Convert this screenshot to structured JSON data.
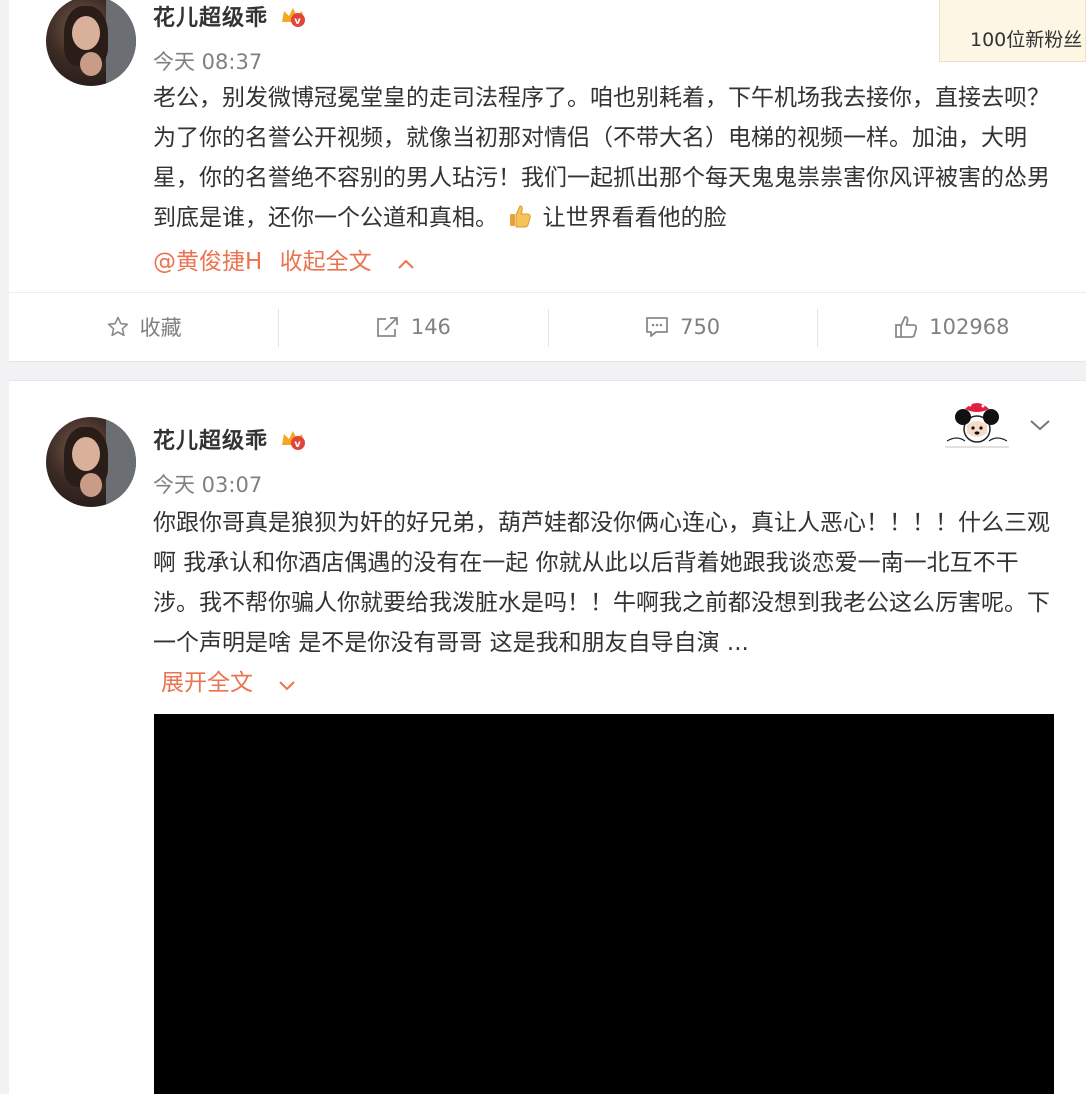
{
  "notification": {
    "text": "100位新粉丝"
  },
  "posts": [
    {
      "username": "花儿超级乖",
      "timestamp": "今天 08:37",
      "text": "老公，别发微博冠冕堂皇的走司法程序了。咱也别耗着，下午机场我去接你，直接去呗？为了你的名誉公开视频，就像当初那对情侣（不带大名）电梯的视频一样。加油，大明星，你的名誉绝不容别的男人玷污！我们一起抓出那个每天鬼鬼祟祟害你风评被害的怂男到底是谁，还你一个公道和真相。",
      "emoji_name": "thumbs-up-emoji",
      "text_after_emoji": "让世界看看他的脸",
      "mention": "@黄俊捷H",
      "collapse_label": "收起全文",
      "actions": {
        "favorite_label": "收藏",
        "repost_count": "146",
        "comment_count": "750",
        "like_count": "102968"
      }
    },
    {
      "username": "花儿超级乖",
      "timestamp": "今天 03:07",
      "text": "你跟你哥真是狼狈为奸的好兄弟，葫芦娃都没你俩心连心，真让人恶心！！！！什么三观啊 我承认和你酒店偶遇的没有在一起 你就从此以后背着她跟我谈恋爱一南一北互不干涉。我不帮你骗人你就要给我泼脏水是吗！！牛啊我之前都没想到我老公这么厉害呢。下一个声明是啥 是不是你没有哥哥 这是我和朋友自导自演 ...",
      "expand_label": "展开全文"
    }
  ],
  "colors": {
    "link": "#eb7350",
    "text": "#333333",
    "muted": "#808080",
    "notice_bg": "#fdf6e5"
  }
}
